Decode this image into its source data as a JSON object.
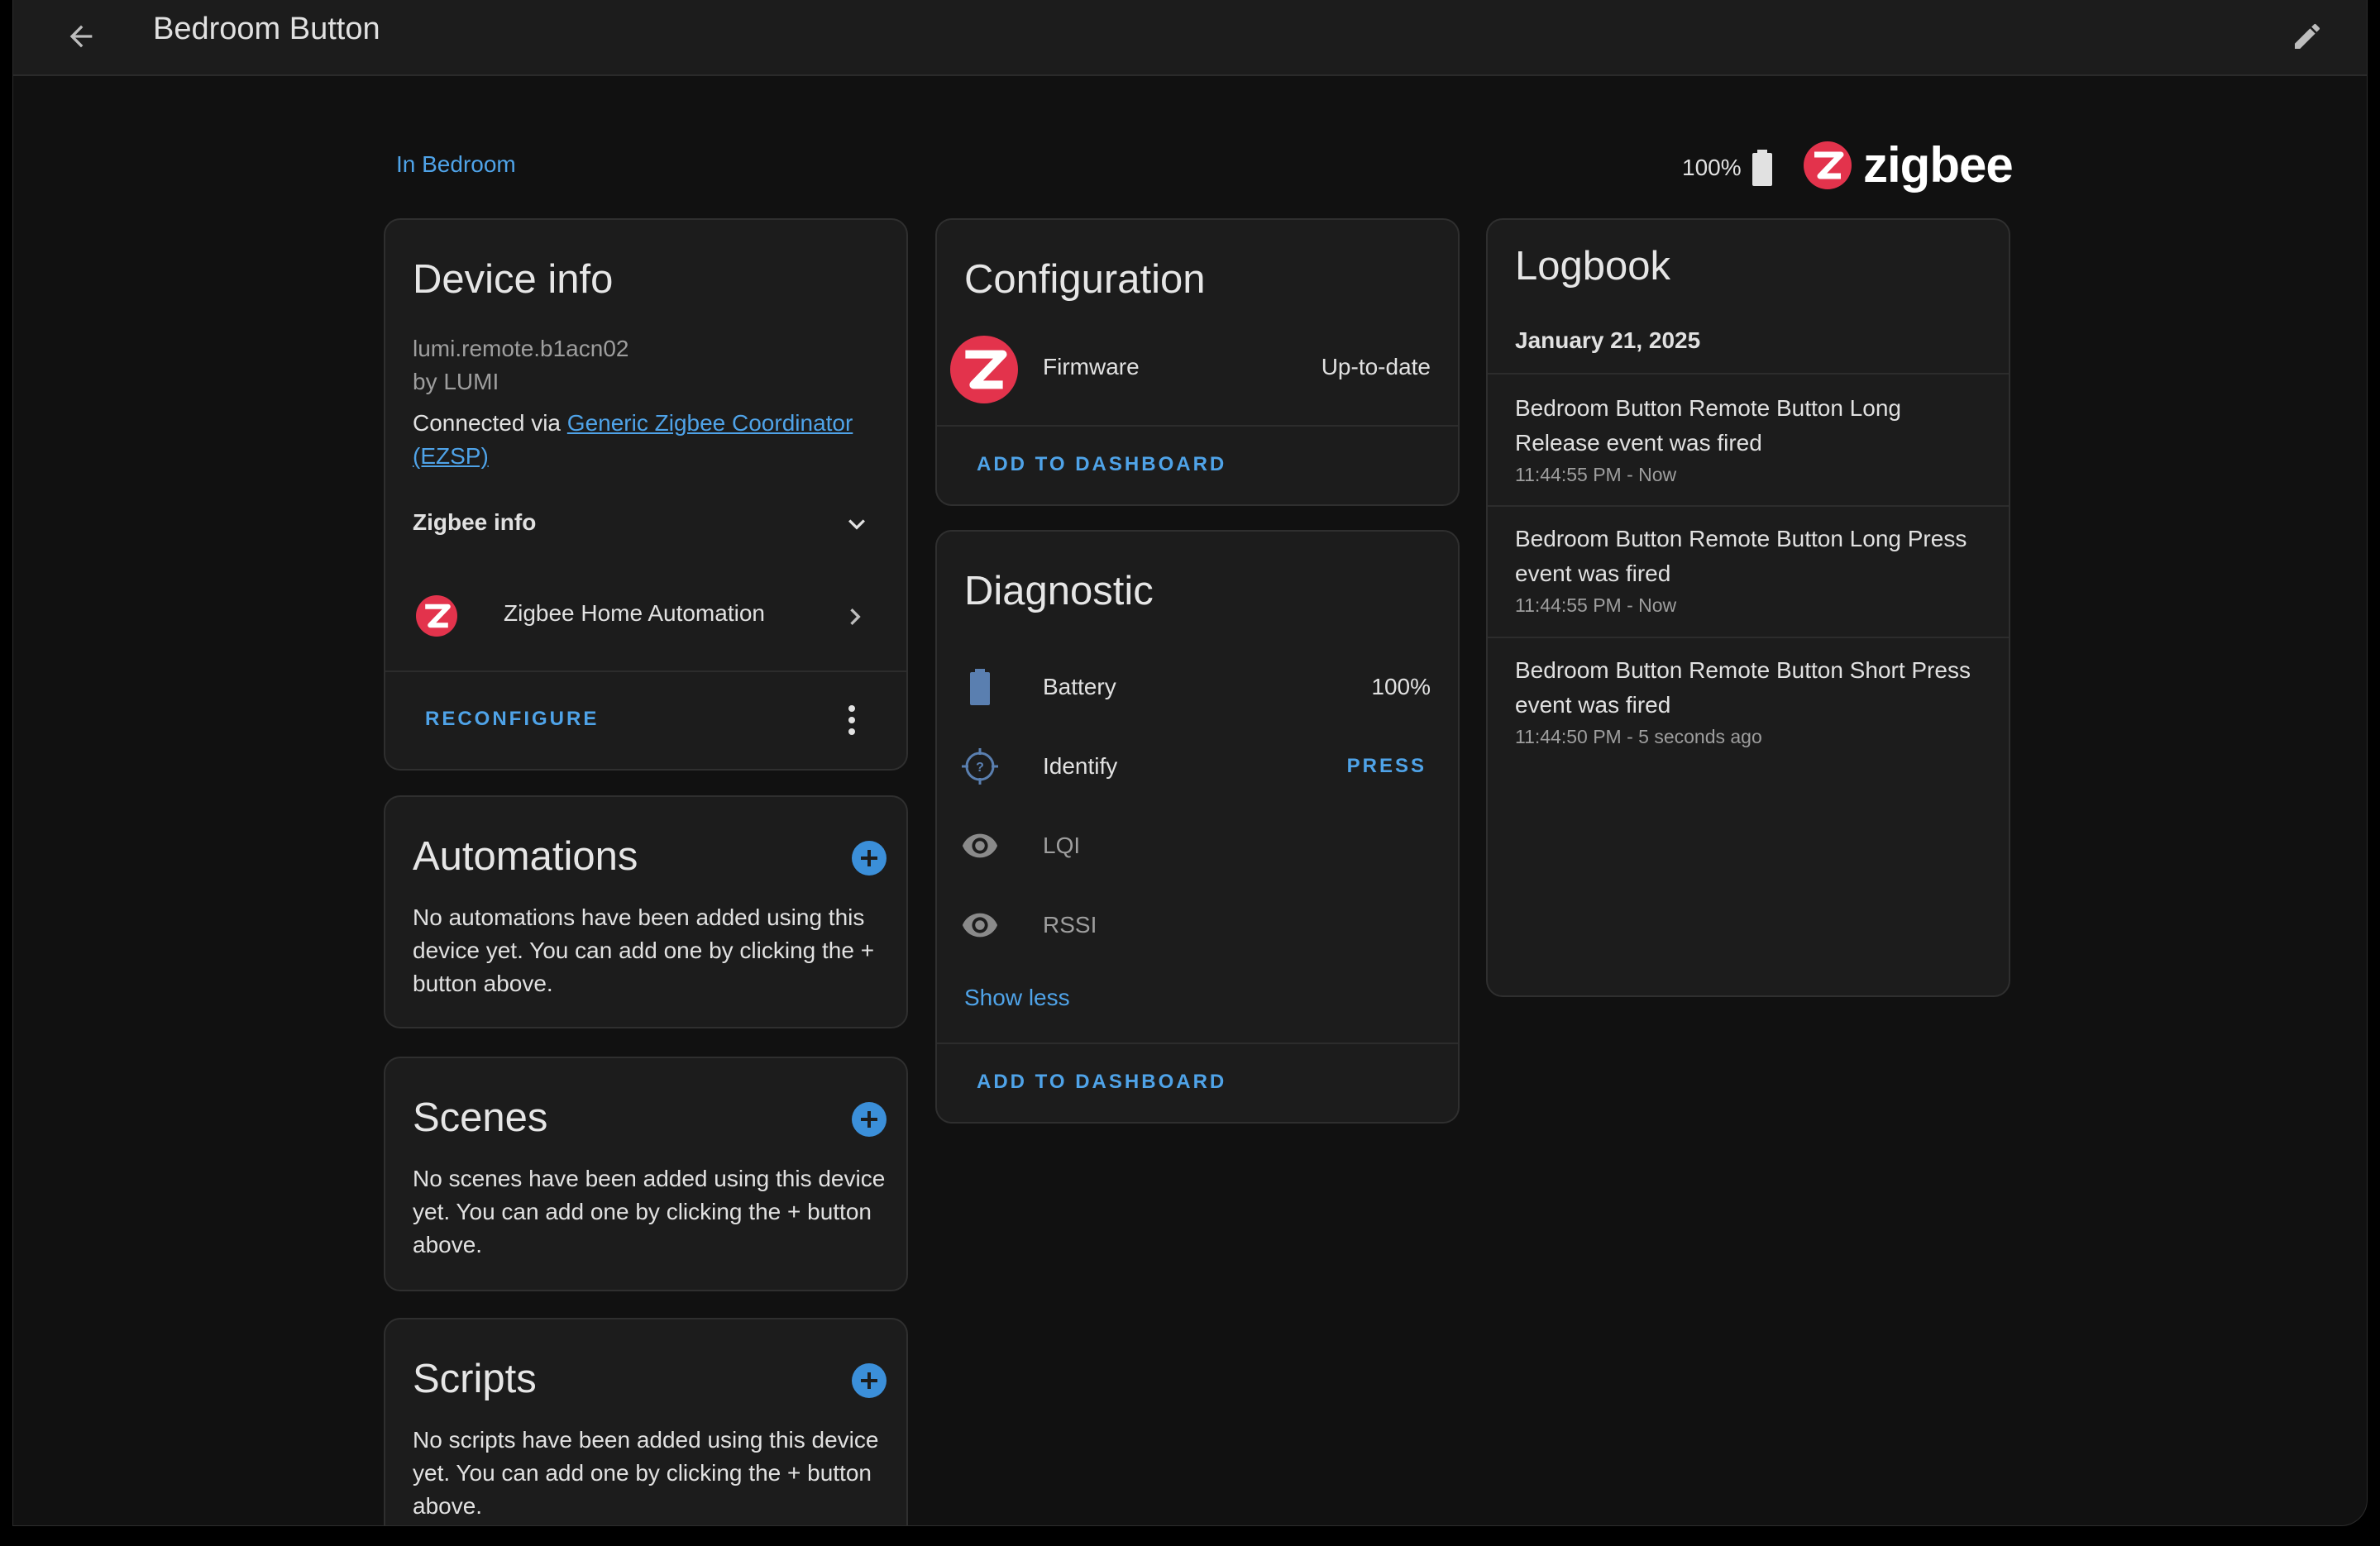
{
  "header": {
    "title": "Bedroom Button"
  },
  "area": {
    "link": "In Bedroom"
  },
  "battery_badge": {
    "value": "100%"
  },
  "brand": {
    "logo_text": "zigbee"
  },
  "device_info": {
    "title": "Device info",
    "model": "lumi.remote.b1acn02",
    "manufacturer": "by LUMI",
    "connected_prefix": "Connected via",
    "connected_link_line1": "Generic Zigbee Coordinator",
    "connected_link_line2": "(EZSP)",
    "zigbee_info_label": "Zigbee info",
    "integration": "Zigbee Home Automation",
    "reconfigure_label": "RECONFIGURE"
  },
  "automations": {
    "title": "Automations",
    "text": "No automations have been added using this device yet. You can add one by clicking the + button above."
  },
  "scenes": {
    "title": "Scenes",
    "text": "No scenes have been added using this device yet. You can add one by clicking the + button above."
  },
  "scripts": {
    "title": "Scripts",
    "text": "No scripts have been added using this device yet. You can add one by clicking the + button above."
  },
  "configuration": {
    "title": "Configuration",
    "firmware_label": "Firmware",
    "firmware_value": "Up-to-date",
    "add_to_dashboard": "ADD TO DASHBOARD"
  },
  "diagnostic": {
    "title": "Diagnostic",
    "rows": [
      {
        "label": "Battery",
        "value": "100%",
        "icon": "battery-icon"
      },
      {
        "label": "Identify",
        "value": "PRESS",
        "icon": "crosshair-help-icon"
      },
      {
        "label": "LQI",
        "value": "",
        "icon": "eye-icon"
      },
      {
        "label": "RSSI",
        "value": "",
        "icon": "eye-icon"
      }
    ],
    "show_less": "Show less",
    "add_to_dashboard": "ADD TO DASHBOARD"
  },
  "logbook": {
    "title": "Logbook",
    "date": "January 21, 2025",
    "entries": [
      {
        "line1": "Bedroom Button Remote Button Long",
        "line2": "Release event was fired",
        "time": "11:44:55 PM - Now"
      },
      {
        "line1": "Bedroom Button Remote Button Long Press",
        "line2": "event was fired",
        "time": "11:44:55 PM - Now"
      },
      {
        "line1": "Bedroom Button Remote Button Short Press",
        "line2": "event was fired",
        "time": "11:44:50 PM - 5 seconds ago"
      }
    ]
  },
  "colors": {
    "accent": "#4fa3e8",
    "zigbee_red": "#e3334c",
    "background": "#111111",
    "card": "#1c1c1c"
  }
}
